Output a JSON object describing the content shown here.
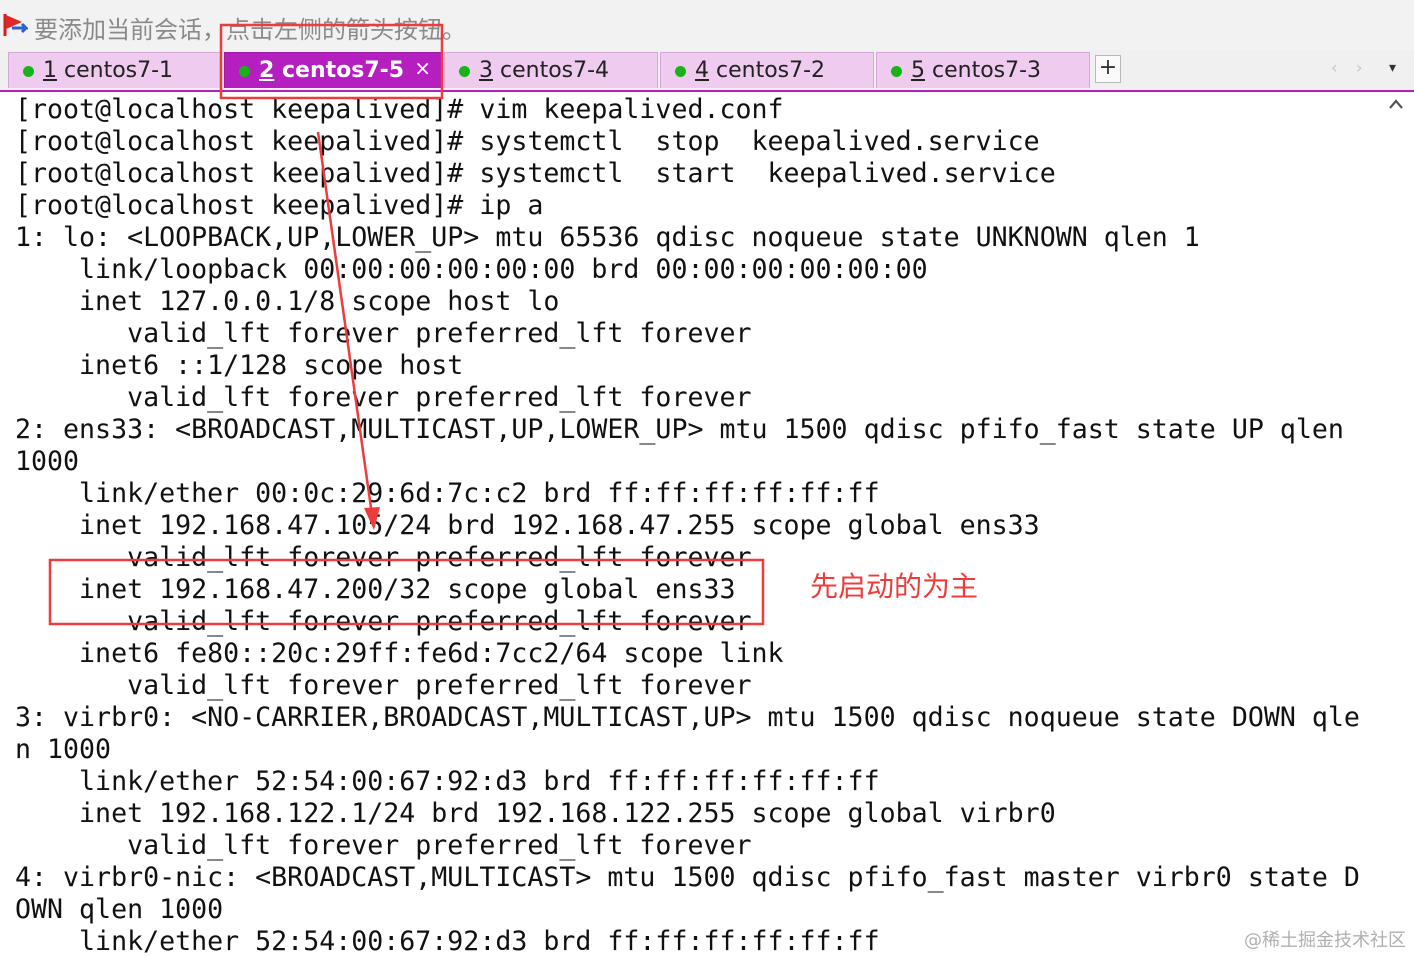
{
  "hint_bar": {
    "text": "要添加当前会话，点击左侧的箭头按钮。",
    "icon": "red-arrow-flag-icon"
  },
  "tabs": [
    {
      "number": "1",
      "name": "centos7-1",
      "active": false
    },
    {
      "number": "2",
      "name": "centos7-5",
      "active": true
    },
    {
      "number": "3",
      "name": "centos7-4",
      "active": false
    },
    {
      "number": "4",
      "name": "centos7-2",
      "active": false
    },
    {
      "number": "5",
      "name": "centos7-3",
      "active": false
    }
  ],
  "tab_bar": {
    "add_label": "+",
    "close_glyph": "×",
    "scroll_left": "‹",
    "scroll_right": "›",
    "menu_glyph": "▾"
  },
  "terminal": {
    "lines": [
      "[root@localhost keepalived]# vim keepalived.conf",
      "[root@localhost keepalived]# systemctl  stop  keepalived.service",
      "[root@localhost keepalived]# systemctl  start  keepalived.service",
      "[root@localhost keepalived]# ip a",
      "1: lo: <LOOPBACK,UP,LOWER_UP> mtu 65536 qdisc noqueue state UNKNOWN qlen 1",
      "    link/loopback 00:00:00:00:00:00 brd 00:00:00:00:00:00",
      "    inet 127.0.0.1/8 scope host lo",
      "       valid_lft forever preferred_lft forever",
      "    inet6 ::1/128 scope host",
      "       valid_lft forever preferred_lft forever",
      "2: ens33: <BROADCAST,MULTICAST,UP,LOWER_UP> mtu 1500 qdisc pfifo_fast state UP qlen",
      "1000",
      "    link/ether 00:0c:29:6d:7c:c2 brd ff:ff:ff:ff:ff:ff",
      "    inet 192.168.47.105/24 brd 192.168.47.255 scope global ens33",
      "       valid_lft forever preferred_lft forever",
      "    inet 192.168.47.200/32 scope global ens33",
      "       valid_lft forever preferred_lft forever",
      "    inet6 fe80::20c:29ff:fe6d:7cc2/64 scope link",
      "       valid_lft forever preferred_lft forever",
      "3: virbr0: <NO-CARRIER,BROADCAST,MULTICAST,UP> mtu 1500 qdisc noqueue state DOWN qle",
      "n 1000",
      "    link/ether 52:54:00:67:92:d3 brd ff:ff:ff:ff:ff:ff",
      "    inet 192.168.122.1/24 brd 192.168.122.255 scope global virbr0",
      "       valid_lft forever preferred_lft forever",
      "4: virbr0-nic: <BROADCAST,MULTICAST> mtu 1500 qdisc pfifo_fast master virbr0 state D",
      "OWN qlen 1000",
      "    link/ether 52:54:00:67:92:d3 brd ff:ff:ff:ff:ff:ff"
    ]
  },
  "annotation": {
    "note": "先启动的为主",
    "color": "#ee3b3b"
  },
  "watermark": "@稀土掘金技术社区",
  "colors": {
    "active_tab": "#b61fbf",
    "inactive_tab": "#eecbef",
    "status_dot": "#19b319"
  }
}
